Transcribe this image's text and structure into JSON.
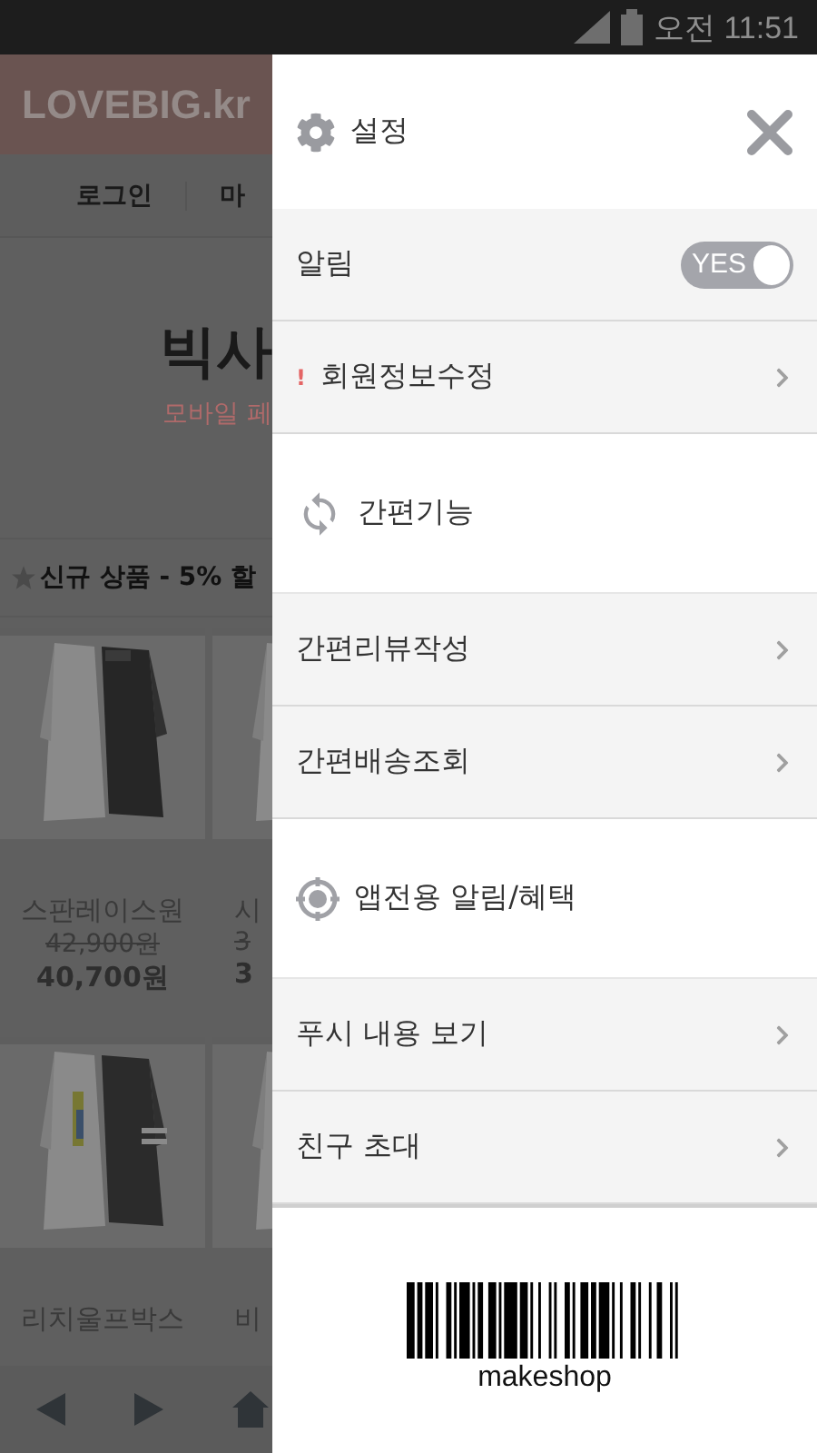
{
  "status_bar": {
    "time": "오전 11:51"
  },
  "page": {
    "logo": "LOVEBIG.kr",
    "nav": [
      "로그인",
      "마"
    ],
    "banner": {
      "title": "빅사",
      "subtitle": "모바일 페"
    },
    "section_title": "**신규 상품** - 5% 할",
    "products": [
      {
        "name": "스판레이스원",
        "old_price": "42,900원",
        "price": "40,700원"
      },
      {
        "name": "시",
        "old_price": "3",
        "price": "3"
      },
      {
        "name": "리치울프박스"
      },
      {
        "name": "비"
      }
    ]
  },
  "drawer": {
    "title": "설정",
    "rows": [
      {
        "kind": "toggle",
        "label": "알림",
        "toggle": {
          "label": "YES",
          "on": true
        }
      },
      {
        "kind": "link",
        "label": "회원정보수정",
        "alert": true,
        "alert_mark": "!"
      }
    ],
    "groups": [
      {
        "title": "간편기능",
        "items": [
          {
            "label": "간편리뷰작성",
            "alert": false
          },
          {
            "label": "간편배송조회",
            "alert": false
          }
        ]
      },
      {
        "title": "앱전용 알림/혜택",
        "items": [
          {
            "label": "푸시 내용 보기",
            "alert": false
          },
          {
            "label": "친구 초대",
            "alert": false
          }
        ]
      }
    ],
    "barcode": {
      "caption": "makeshop"
    }
  }
}
